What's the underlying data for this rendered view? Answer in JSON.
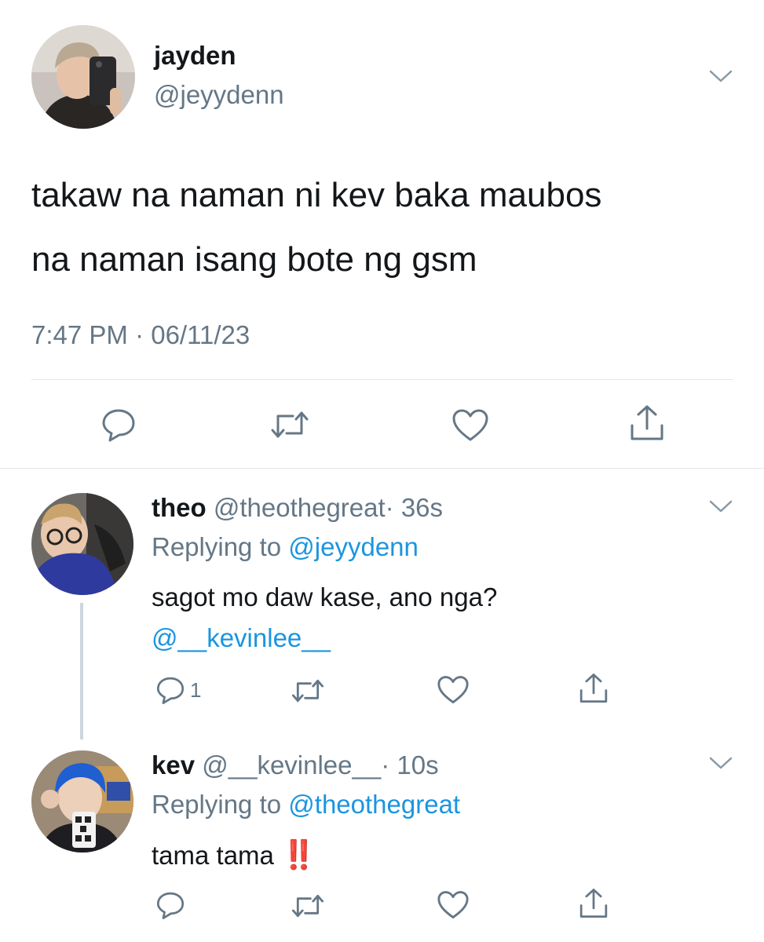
{
  "tweet": {
    "author": {
      "name": "jayden",
      "handle": "@jeyydenn"
    },
    "text_line1": "takaw na naman ni kev baka maubos",
    "text_line2": "na naman isang bote ng gsm",
    "timestamp": "7:47 PM · 06/11/23"
  },
  "replies": [
    {
      "name": "theo",
      "handle": "@theothegreat",
      "age": "· 36s",
      "replying_prefix": "Replying to",
      "replying_to": "@jeyydenn",
      "text_line1": "sagot mo daw kase, ano nga?",
      "mention": "@__kevinlee__",
      "reply_count": "1"
    },
    {
      "name": "kev",
      "handle": "@__kevinlee__",
      "age": "· 10s",
      "replying_prefix": "Replying to",
      "replying_to": "@theothegreat",
      "text": "tama tama",
      "emoji": "‼️"
    }
  ],
  "icons": {
    "reply": "speech-bubble-icon",
    "retweet": "retweet-icon",
    "like": "heart-icon",
    "share": "share-icon",
    "menu": "chevron-down-icon"
  },
  "colors": {
    "text": "#14171a",
    "secondary": "#657786",
    "link": "#1b95e0",
    "divider": "#e1e8ed",
    "thread_line": "#ccd6dd",
    "emoji_red": "#e0202a"
  }
}
